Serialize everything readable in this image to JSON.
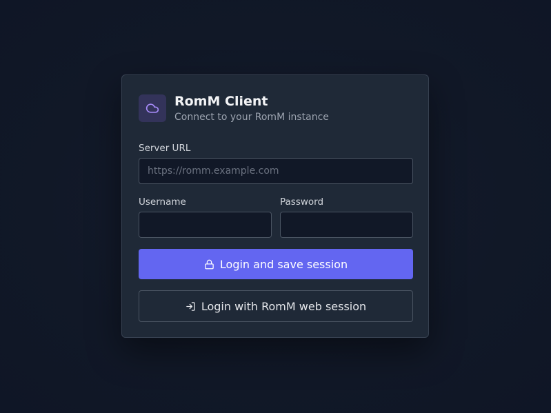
{
  "app": {
    "title": "RomM Client",
    "subtitle": "Connect to your RomM instance",
    "logo_icon": "cloud-icon",
    "accent_color": "#6366f1"
  },
  "form": {
    "server_url": {
      "label": "Server URL",
      "value": "",
      "placeholder": "https://romm.example.com"
    },
    "username": {
      "label": "Username",
      "value": "",
      "placeholder": ""
    },
    "password": {
      "label": "Password",
      "value": "",
      "placeholder": ""
    }
  },
  "actions": {
    "login_save": {
      "label": "Login and save session",
      "icon": "lock-icon"
    },
    "login_web": {
      "label": "Login with RomM web session",
      "icon": "log-in-icon"
    }
  }
}
